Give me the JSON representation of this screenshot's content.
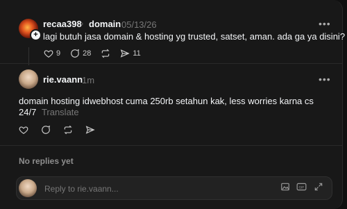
{
  "post": {
    "username": "recaa398",
    "topic": "domain",
    "date": "05/13/26",
    "text": "lagi butuh jasa domain & hosting yg trusted, satset, aman. ada ga ya disini?",
    "likes": "9",
    "comments": "28",
    "shares": "11",
    "more_label": "•••"
  },
  "reply": {
    "username": "rie.vaann",
    "time": "1m",
    "text_line1": "domain hosting idwebhost cuma 250rb setahun kak, less worries karna cs",
    "text_line2": "24/7",
    "translate_label": "Translate",
    "more_label": "•••"
  },
  "replies_status": "No replies yet",
  "composer": {
    "placeholder": "Reply to rie.vaann..."
  }
}
